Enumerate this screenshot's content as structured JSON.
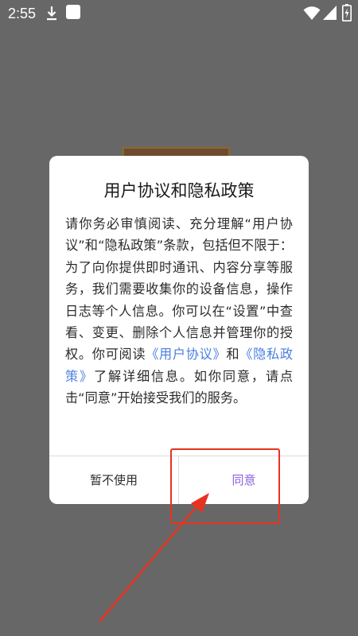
{
  "status_bar": {
    "time": "2:55"
  },
  "dialog": {
    "title": "用户协议和隐私政策",
    "body_intro": "请你务必审慎阅读、充分理解“用户协议”和“隐私政策”条款，包括但不限于：为了向你提供即时通讯、内容分享等服务，我们需要收集你的设备信息，操作日志等个人信息。你可以在“设置”中查看、变更、删除个人信息并管理你的授权。你可阅读",
    "link_user_agreement": "《用户协议》",
    "body_and": "和",
    "link_privacy_policy": "《隐私政策》",
    "body_outro": "了解详细信息。如你同意，请点击“同意”开始接受我们的服务。",
    "decline_label": "暂不使用",
    "agree_label": "同意"
  },
  "colors": {
    "overlay": "#676767",
    "link": "#4a7fe0",
    "agree": "#8a5fe0",
    "annotation": "#e8321f"
  },
  "icons": [
    "download-icon",
    "app-notification-icon",
    "wifi-icon",
    "signal-icon",
    "battery-charging-icon"
  ]
}
